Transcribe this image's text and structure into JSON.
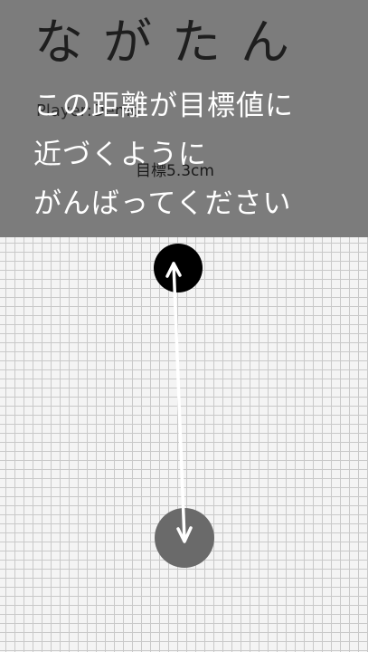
{
  "header": {
    "app_title": "ながたん",
    "player": "Player:Demo",
    "target": "目標5.3cm"
  },
  "tutorial": {
    "lines": [
      "この距離が目標値に",
      "近づくように",
      "がんばってください"
    ]
  },
  "colors": {
    "header_bg": "#7c7c7c",
    "field_bg": "#f4f4f4",
    "grid": "#c9c9c9",
    "start_point": "#000000",
    "end_point": "#6a6a6a",
    "arrow": "#ffffff"
  },
  "icons": {
    "start_point": "filled-circle",
    "end_point": "filled-circle",
    "measure_arrow": "double-headed-arrow"
  }
}
